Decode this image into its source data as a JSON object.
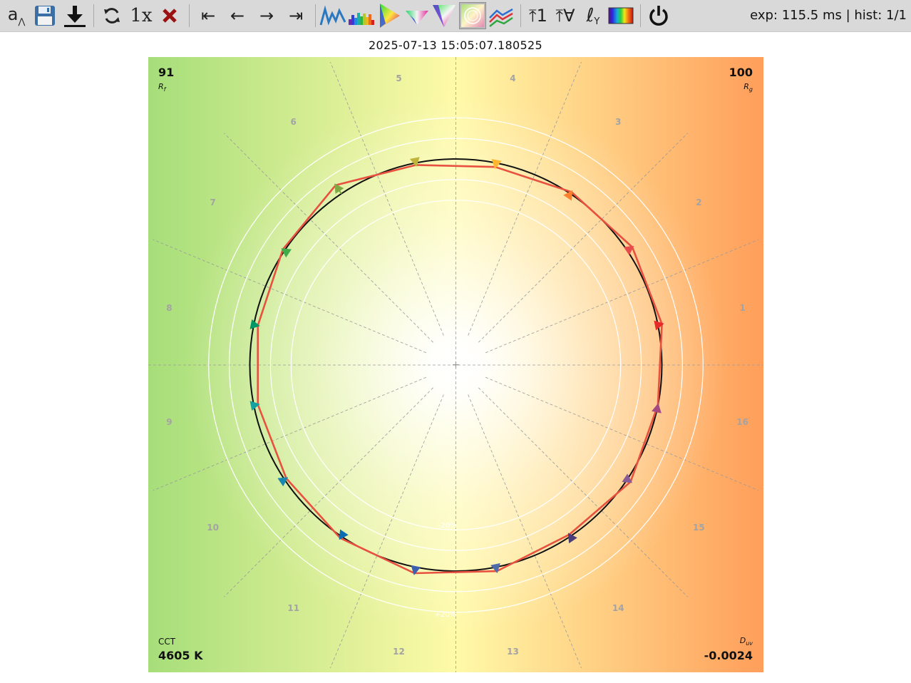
{
  "toolbar": {
    "buttons": [
      {
        "name": "auto-scale-button",
        "icon": "a-caret",
        "label": "a"
      },
      {
        "name": "save-button",
        "icon": "floppy-disk-icon"
      },
      {
        "name": "download-button",
        "icon": "download-icon"
      },
      {
        "name": "refresh-button",
        "icon": "refresh-icon"
      },
      {
        "name": "speed-button",
        "icon": "speed",
        "label": "1x"
      },
      {
        "name": "clear-button",
        "icon": "close-icon"
      },
      {
        "name": "first-button",
        "icon": "first-icon",
        "label": "⇤"
      },
      {
        "name": "prev-button",
        "icon": "prev-icon",
        "label": "←"
      },
      {
        "name": "next-button",
        "icon": "next-icon",
        "label": "→"
      },
      {
        "name": "last-button",
        "icon": "last-icon",
        "label": "⇥"
      },
      {
        "name": "spectrum-line-button",
        "icon": "spectrum-line-icon"
      },
      {
        "name": "spectrum-bar-button",
        "icon": "spectrum-bar-icon"
      },
      {
        "name": "cie1931-button",
        "icon": "cie1931-icon"
      },
      {
        "name": "cie1976-button",
        "icon": "cie1976-icon"
      },
      {
        "name": "cie1960-button",
        "icon": "cie1960-icon"
      },
      {
        "name": "color-vector-button",
        "icon": "color-vector-icon"
      },
      {
        "name": "compare-lines-button",
        "icon": "compare-lines-icon"
      },
      {
        "name": "normalize-one-button",
        "icon": "normalize-one-icon",
        "label": "⤒1"
      },
      {
        "name": "normalize-all-button",
        "icon": "normalize-all-icon",
        "label": "⤒∀"
      },
      {
        "name": "luminance-button",
        "icon": "luminance-icon",
        "label": "ℓ"
      },
      {
        "name": "spectrum-colors-button",
        "icon": "spectrum-colors-icon"
      },
      {
        "name": "power-button",
        "icon": "power-icon"
      }
    ],
    "status": "exp: 115.5 ms | hist: 1/1"
  },
  "title": "2025-07-13 15:05:07.180525",
  "corners": {
    "rf_value": "91",
    "rf_label": "Rf",
    "rg_value": "100",
    "rg_label": "Rg",
    "cct_label": "CCT",
    "cct_value": "4605 K",
    "duv_label": "Duv",
    "duv_value": "-0.0024"
  },
  "ring_labels": {
    "minus": "-20%",
    "plus": "+20%"
  },
  "hue_bin_labels": [
    "1",
    "2",
    "3",
    "4",
    "5",
    "6",
    "7",
    "8",
    "9",
    "10",
    "11",
    "12",
    "13",
    "14",
    "15",
    "16"
  ],
  "hue_bin_colors": [
    "#e62828",
    "#e74b4b",
    "#fb812f",
    "#ffb52e",
    "#c0b43b",
    "#7ea943",
    "#3fad4b",
    "#009868",
    "#16a1a1",
    "#1887b1",
    "#0b6cb2",
    "#3e5fb0",
    "#4f6ba8",
    "#4a3d78",
    "#8a5b95",
    "#a54a80"
  ],
  "chart_data": {
    "type": "color-vector-graphic",
    "bins": [
      "1",
      "2",
      "3",
      "4",
      "5",
      "6",
      "7",
      "8",
      "9",
      "10",
      "11",
      "12",
      "13",
      "14",
      "15",
      "16"
    ],
    "test_radius_ratio": [
      1.02,
      1.03,
      1.01,
      0.98,
      0.99,
      1.05,
      1.01,
      0.98,
      0.98,
      0.99,
      1.01,
      1.03,
      1.02,
      0.99,
      1.02,
      1.0
    ],
    "reference_radius_ratio": 1.0,
    "rings_percent": [
      -20,
      -10,
      0,
      10,
      20
    ],
    "Rf": 91,
    "Rg": 100,
    "CCT_K": 4605,
    "Duv": -0.0024
  }
}
